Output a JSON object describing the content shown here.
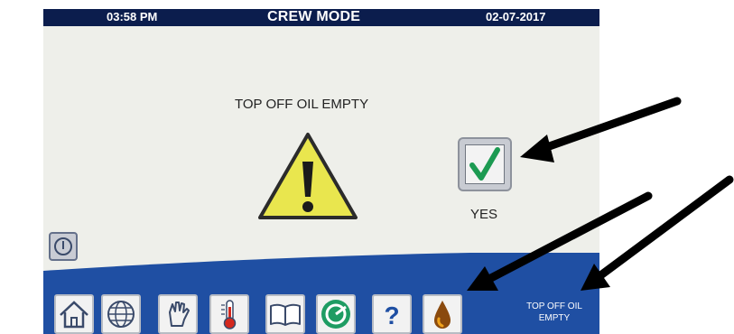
{
  "status_bar": {
    "time": "03:58 PM",
    "mode": "CREW MODE",
    "date": "02-07-2017"
  },
  "main": {
    "message": "TOP OFF OIL EMPTY",
    "icon": "warning-icon",
    "yes_label": "YES"
  },
  "nav": {
    "buttons": [
      "home-icon",
      "globe-icon",
      "hand-icon",
      "thermometer-icon",
      "book-icon",
      "filter-icon",
      "help-icon",
      "oil-drop-icon"
    ],
    "help_glyph": "?",
    "status_line1": "TOP OFF OIL",
    "status_line2": "EMPTY"
  },
  "colors": {
    "status_bar": "#0b1d4d",
    "bottom_bar": "#1f4fa3",
    "warning_yellow": "#e9e64e",
    "check_green": "#1c9a52"
  }
}
